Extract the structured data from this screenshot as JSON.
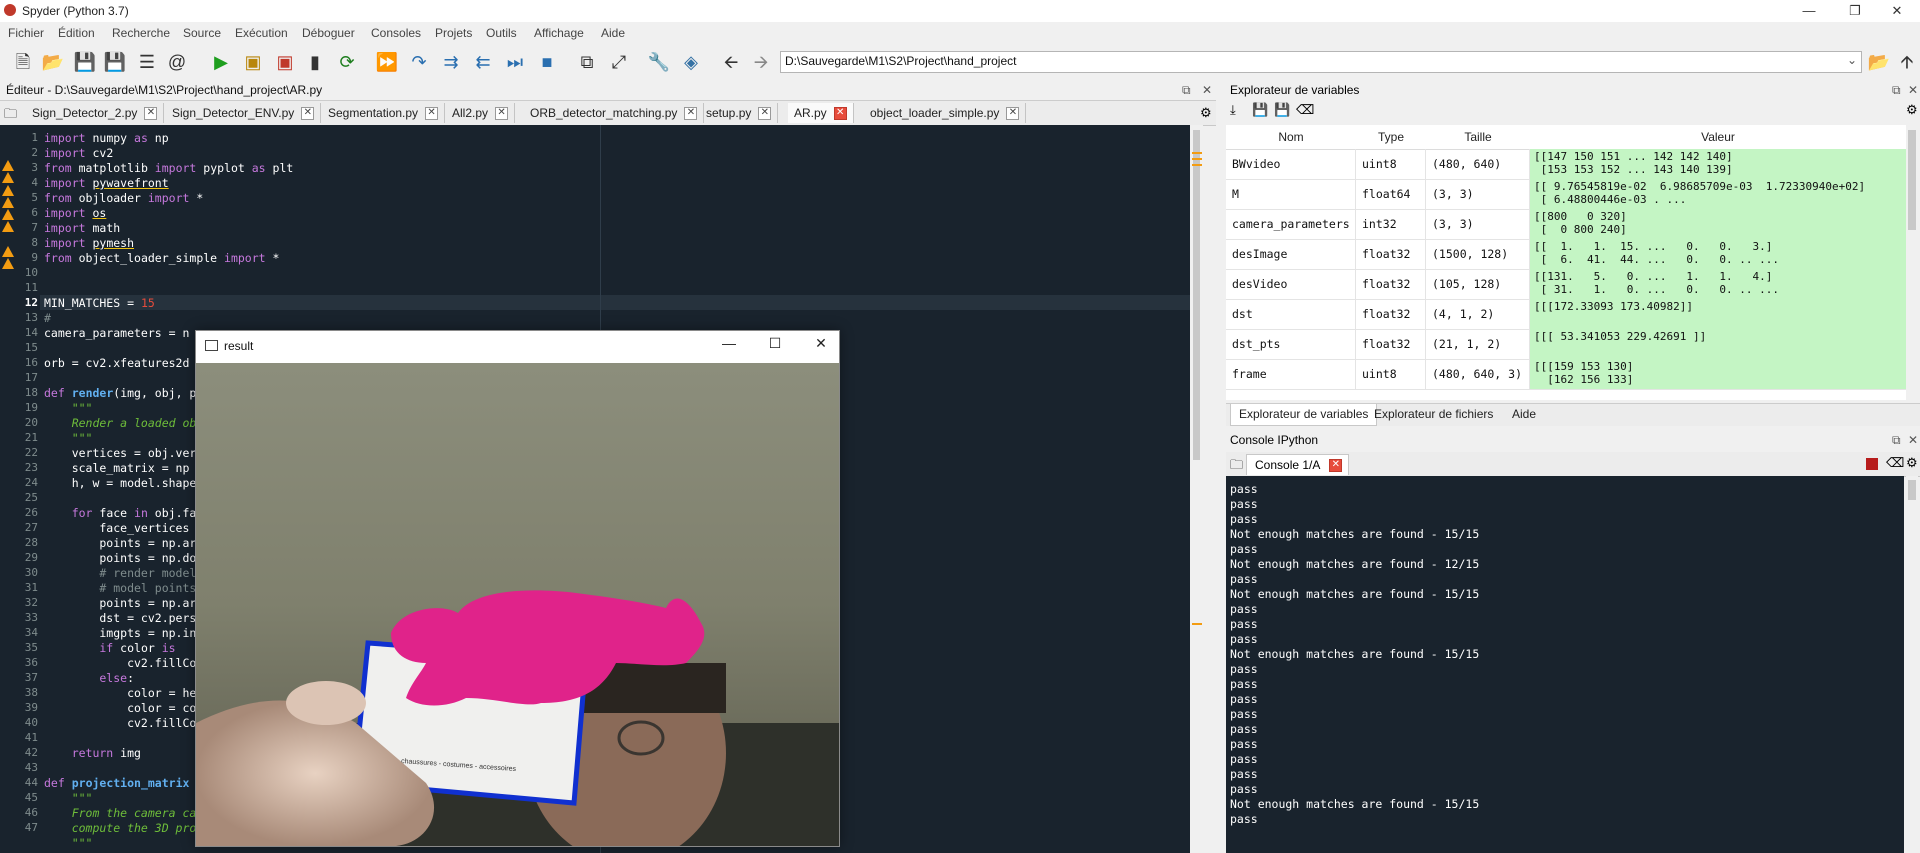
{
  "window": {
    "title": "Spyder (Python 3.7)"
  },
  "menu": [
    "Fichier",
    "Édition",
    "Recherche",
    "Source",
    "Exécution",
    "Déboguer",
    "Consoles",
    "Projets",
    "Outils",
    "Affichage",
    "Aide"
  ],
  "toolbar": {
    "path": "D:\\Sauvegarde\\M1\\S2\\Project\\hand_project"
  },
  "editor": {
    "title": "Éditeur - D:\\Sauvegarde\\M1\\S2\\Project\\hand_project\\AR.py",
    "tabs": [
      "Sign_Detector_2.py",
      "Sign_Detector_ENV.py",
      "Segmentation.py",
      "All2.py",
      "ORB_detector_matching.py",
      "setup.py",
      "AR.py",
      "object_loader_simple.py"
    ],
    "active_tab": "AR.py",
    "line_numbers": [
      "1",
      "2",
      "3",
      "4",
      "5",
      "6",
      "7",
      "8",
      "9",
      "10",
      "11",
      "12",
      "13",
      "14",
      "15",
      "16",
      "17",
      "18",
      "19",
      "20",
      "21",
      "22",
      "23",
      "24",
      "25",
      "26",
      "27",
      "28",
      "29",
      "30",
      "31",
      "32",
      "33",
      "34",
      "35",
      "36",
      "37",
      "38",
      "39",
      "40",
      "41",
      "42",
      "43",
      "44",
      "45",
      "46",
      "47"
    ],
    "current_line": "12",
    "code": {
      "l1a": "import",
      "l1b": " numpy ",
      "l1c": "as",
      "l1d": " np",
      "l2a": "import",
      "l2b": " cv2",
      "l3a": "from",
      "l3b": " matplotlib ",
      "l3c": "import",
      "l3d": " pyplot ",
      "l3e": "as",
      "l3f": " plt",
      "l4a": "import",
      "l4b": "pywavefront",
      "l5a": "from",
      "l5b": " objloader ",
      "l5c": "import",
      "l5d": " *",
      "l6a": "import",
      "l6b": "os",
      "l7a": "import",
      "l7b": " math",
      "l8a": "import",
      "l8b": "pymesh",
      "l9a": "from",
      "l9b": " object_loader_simple ",
      "l9c": "import",
      "l9d": " *",
      "l12a": "MIN_MATCHES = ",
      "l12b": "15",
      "l13": "#",
      "l14": "camera_parameters = n",
      "l16": "orb = cv2.xfeatures2d",
      "l18a": "def",
      "l18b": "render",
      "l18c": "(img, obj, p",
      "l19": "    \"\"\"",
      "l20": "    Render a loaded ob",
      "l21": "    \"\"\"",
      "l22": "    vertices = obj.ver",
      "l23": "    scale_matrix = np",
      "l24": "    h, w = model.shape",
      "l26a": "    for",
      "l26b": " face ",
      "l26c": "in",
      "l26d": " obj.fa",
      "l27": "        face_vertices",
      "l28": "        points = np.ar",
      "l29": "        points = np.do",
      "l30": "        # render model",
      "l31": "        # model points",
      "l32": "        points = np.ar",
      "l33": "        dst = cv2.pers",
      "l34": "        imgpts = np.in",
      "l35a": "        if",
      "l35b": " color ",
      "l35c": "is",
      "l36": "            cv2.fillCo",
      "l37a": "        else",
      "l37b": ":",
      "l38": "            color = he",
      "l39": "            color = co",
      "l40": "            cv2.fillCo",
      "l42a": "    return",
      "l42b": " img",
      "l44a": "def",
      "l44b": "projection_matrix",
      "l45": "    \"\"\"",
      "l46": "    From the camera ca",
      "l47": "    compute the 3D pro",
      "l48": "    \"\"\""
    }
  },
  "result_window": {
    "title": "result",
    "card_text": "chaussures - costumes - accessoires"
  },
  "variable_explorer": {
    "title": "Explorateur de variables",
    "columns": [
      "Nom",
      "Type",
      "Taille",
      "Valeur"
    ],
    "rows": [
      {
        "name": "BWvideo",
        "type": "uint8",
        "size": "(480, 640)",
        "value1": "[[147 150 151 ... 142 142 140]",
        "value2": " [153 153 152 ... 143 140 139]"
      },
      {
        "name": "M",
        "type": "float64",
        "size": "(3, 3)",
        "value1": "[[ 9.76545819e-02  6.98685709e-03  1.72330940e+02]",
        "value2": " [ 6.48800446e-03 . ..."
      },
      {
        "name": "camera_parameters",
        "type": "int32",
        "size": "(3, 3)",
        "value1": "[[800   0 320]",
        "value2": " [  0 800 240]"
      },
      {
        "name": "desImage",
        "type": "float32",
        "size": "(1500, 128)",
        "value1": "[[  1.   1.  15. ...   0.   0.   3.]",
        "value2": " [  6.  41.  44. ...   0.   0. .. ..."
      },
      {
        "name": "desVideo",
        "type": "float32",
        "size": "(105, 128)",
        "value1": "[[131.   5.   0. ...   1.   1.   4.]",
        "value2": " [ 31.   1.   0. ...   0.   0. .. ..."
      },
      {
        "name": "dst",
        "type": "float32",
        "size": "(4, 1, 2)",
        "value1": "[[[172.33093 173.40982]]",
        "value2": ""
      },
      {
        "name": "dst_pts",
        "type": "float32",
        "size": "(21, 1, 2)",
        "value1": "[[[ 53.341053 229.42691 ]]",
        "value2": ""
      },
      {
        "name": "frame",
        "type": "uint8",
        "size": "(480, 640, 3)",
        "value1": "[[[159 153 130]",
        "value2": "  [162 156 133]"
      }
    ],
    "bottom_tabs": [
      "Explorateur de variables",
      "Explorateur de fichiers",
      "Aide"
    ]
  },
  "console": {
    "title": "Console IPython",
    "tab": "Console 1/A",
    "lines": [
      "pass",
      "pass",
      "pass",
      "Not enough matches are found - 15/15",
      "pass",
      "Not enough matches are found - 12/15",
      "pass",
      "Not enough matches are found - 15/15",
      "pass",
      "pass",
      "pass",
      "Not enough matches are found - 15/15",
      "pass",
      "pass",
      "pass",
      "pass",
      "pass",
      "pass",
      "pass",
      "pass",
      "pass",
      "Not enough matches are found - 15/15",
      "pass"
    ]
  }
}
